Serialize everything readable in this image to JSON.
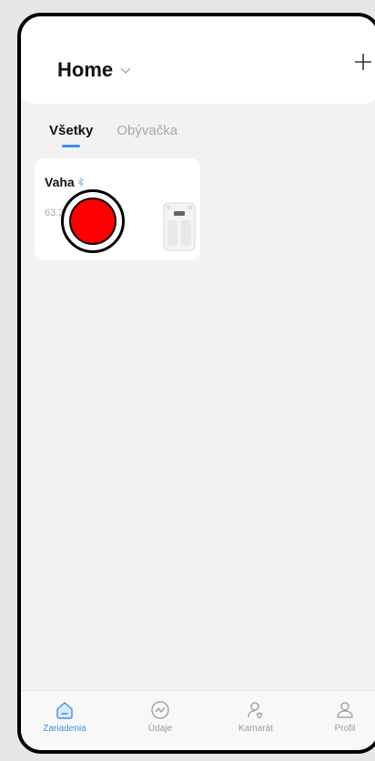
{
  "header": {
    "title": "Home"
  },
  "tabs": [
    {
      "label": "Všetky",
      "active": true
    },
    {
      "label": "Obývačka",
      "active": false
    }
  ],
  "device": {
    "name": "Vaha",
    "weight": "63.3 kg"
  },
  "nav": [
    {
      "label": "Zariadenia",
      "icon": "home-icon",
      "active": true
    },
    {
      "label": "Údaje",
      "icon": "chart-icon",
      "active": false
    },
    {
      "label": "Kamarát",
      "icon": "friends-icon",
      "active": false
    },
    {
      "label": "Profil",
      "icon": "profile-icon",
      "active": false
    }
  ],
  "colors": {
    "accent": "#3d8ef0",
    "marker": "#ff0000",
    "background": "#f2f2f2"
  }
}
